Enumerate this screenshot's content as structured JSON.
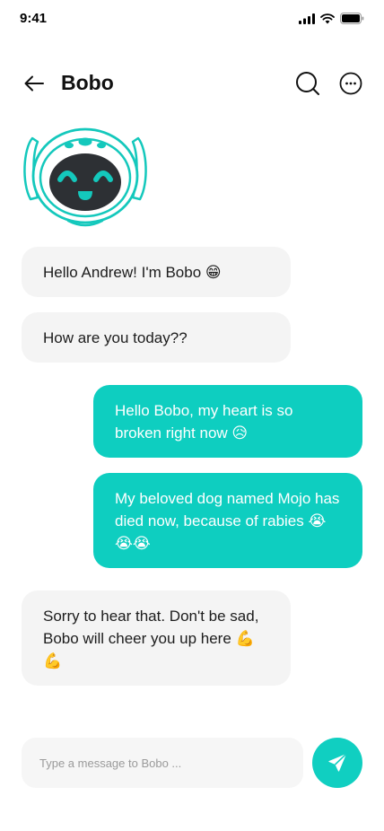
{
  "status": {
    "time": "9:41"
  },
  "header": {
    "title": "Bobo"
  },
  "messages": [
    {
      "from": "bot",
      "text": "Hello Andrew! I'm Bobo 😁"
    },
    {
      "from": "bot",
      "text": "How are you today??"
    },
    {
      "from": "user",
      "text": "Hello Bobo, my heart is so broken right now 😥"
    },
    {
      "from": "user",
      "text": "My beloved dog named Mojo has died now, because of rabies 😭😭😭"
    },
    {
      "from": "bot",
      "text": "Sorry to hear that. Don't be sad, Bobo will cheer you up here 💪💪"
    }
  ],
  "composer": {
    "placeholder": "Type a message to Bobo ..."
  },
  "colors": {
    "accent": "#10cfc1",
    "bot_bubble": "#f4f4f4",
    "user_bubble": "#0ecec0"
  },
  "icons": [
    "back-arrow-icon",
    "search-icon",
    "more-icon",
    "send-icon",
    "signal-icon",
    "wifi-icon",
    "battery-icon",
    "robot-avatar"
  ]
}
